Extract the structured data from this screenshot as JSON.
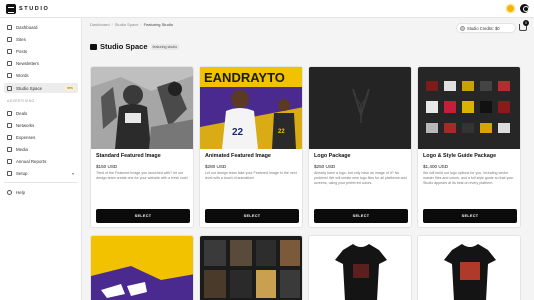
{
  "brand": {
    "name": "STUDIO"
  },
  "sidebar": {
    "items": [
      {
        "label": "Dashboard"
      },
      {
        "label": "Sites"
      },
      {
        "label": "Posts"
      },
      {
        "label": "Newsletters"
      },
      {
        "label": "Words"
      },
      {
        "label": "Studio Space",
        "badge": "new"
      }
    ],
    "section_label": "ADVERTISING",
    "ad_items": [
      {
        "label": "Deals"
      },
      {
        "label": "Networks"
      },
      {
        "label": "Expenses"
      },
      {
        "label": "Media"
      },
      {
        "label": "Annual Reports"
      },
      {
        "label": "Setup"
      }
    ],
    "help_label": "Help"
  },
  "breadcrumb": [
    "Dashboard",
    "Studio Space",
    "Featuring Studio"
  ],
  "header": {
    "credits_label": "Studio Credits: $0",
    "cart_count": "0"
  },
  "page": {
    "title": "Studio Space",
    "tag": "featuring studio"
  },
  "products": [
    {
      "title": "Standard Featured Image",
      "price": "$150 USD",
      "description": "Tired of the Featured Image you launched with? let our design team create one for your website with a fresh look!",
      "button": "SELECT"
    },
    {
      "title": "Animated Featured Image",
      "price": "$280 USD",
      "description": "Let our design team take your Featured Image to the next level with a touch of animation!",
      "button": "SELECT"
    },
    {
      "title": "Logo Package",
      "price": "$250 USD",
      "description": "Already have a logo, but only have an image of it? No problem! We will create new logo files for all platforms and screens, using your preferred colors.",
      "button": "SELECT"
    },
    {
      "title": "Logo & Style Guide Package",
      "price": "$1,400 USD",
      "description": "We will build out logo options for you, including vector master files and colors, and a full style guide so that your Studio appears at its best on every platform.",
      "button": "SELECT"
    }
  ],
  "colors": {
    "accent": "#0b0b0b",
    "sun": "#f5b400",
    "purple": "#4b2a8f",
    "gold": "#f2c200"
  }
}
